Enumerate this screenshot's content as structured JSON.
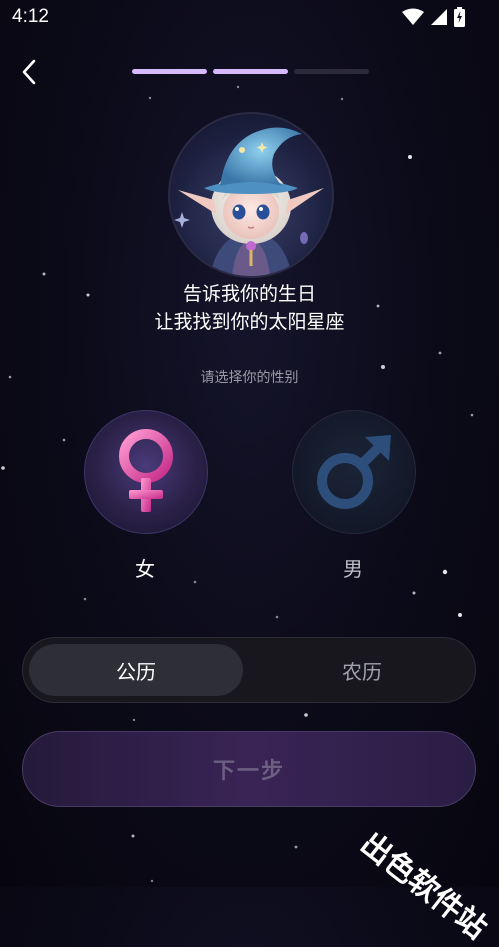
{
  "status_bar": {
    "time": "4:12"
  },
  "header": {
    "back_icon": "chevron-left-icon",
    "progress_steps": 3,
    "progress_completed": 2
  },
  "colors": {
    "progress_active": "#d7b9ff",
    "progress_inactive": "#2c2a3a",
    "female_accent": "#e35aa8",
    "male_accent": "#2d4d7a"
  },
  "avatar": {
    "description_icon": "elf-wizard-avatar"
  },
  "heading": {
    "line1": "告诉我你的生日",
    "line2": "让我找到你的太阳星座"
  },
  "gender": {
    "prompt": "请选择你的性别",
    "options": [
      {
        "label": "女",
        "icon": "female-symbol-icon",
        "selected": true
      },
      {
        "label": "男",
        "icon": "male-symbol-icon",
        "selected": false
      }
    ]
  },
  "calendar": {
    "options": [
      {
        "label": "公历",
        "selected": true
      },
      {
        "label": "农历",
        "selected": false
      }
    ]
  },
  "next_button": {
    "label": "下一步",
    "enabled": false
  },
  "watermark": "出色软件站"
}
